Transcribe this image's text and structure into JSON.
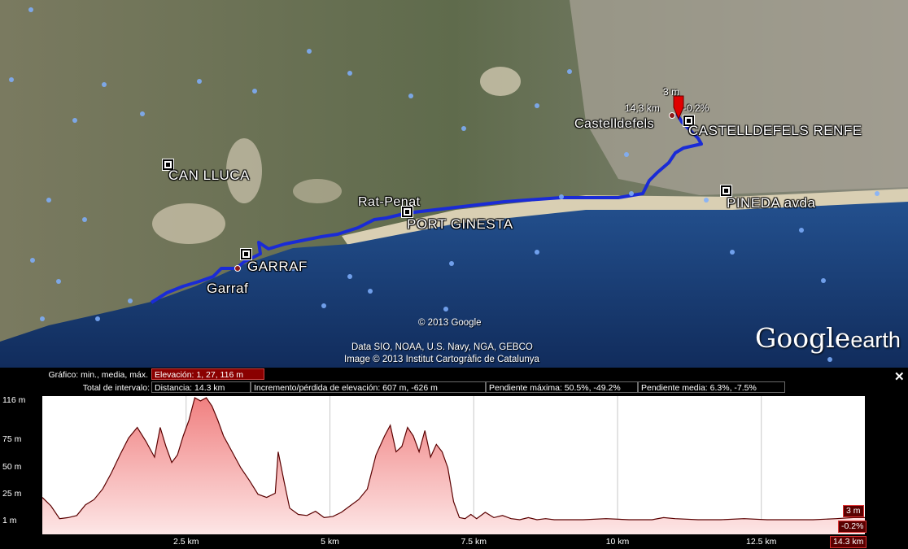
{
  "map": {
    "places": [
      {
        "id": "can-lluca",
        "label": "CAN LLUCA"
      },
      {
        "id": "garraf-upper",
        "label": "GARRAF"
      },
      {
        "id": "garraf",
        "label": "Garraf"
      },
      {
        "id": "rat-penat",
        "label": "Rat-Penat"
      },
      {
        "id": "port-ginesta",
        "label": "PORT GINESTA"
      },
      {
        "id": "castelldefels",
        "label": "Castelldefels"
      },
      {
        "id": "castelldefels-renfe",
        "label": "CASTELLDEFELS RENFE"
      },
      {
        "id": "pineda",
        "label": "PINEDA avda"
      }
    ],
    "marker": {
      "elevation": "3 m",
      "distance": "14,3 km",
      "slope": "-0.2%"
    },
    "credits": {
      "copyright": "© 2013 Google",
      "data": "Data SIO, NOAA, U.S. Navy, NGA, GEBCO",
      "image": "Image © 2013 Institut Cartogràfic de Catalunya"
    },
    "logo": {
      "google": "Google",
      "earth": "earth"
    },
    "colors": {
      "track": "#1a2bd6",
      "sea": "#1b3f7a",
      "land": "#6f7358"
    }
  },
  "panel": {
    "row1_label": "Gráfico: min., media, máx.",
    "row2_label": "Total de intervalo:",
    "stats": {
      "elevation": "Elevación: 1, 27, 116 m",
      "distance": "Distancia: 14.3 km",
      "gain_loss": "Incremento/pérdida de elevación: 607 m, -626 m",
      "max_slope": "Pendiente máxima: 50.5%, -49.2%",
      "avg_slope": "Pendiente media: 6.3%, -7.5%"
    },
    "close_label": "✕",
    "cursor": {
      "elevation": "3 m",
      "slope": "-0.2%",
      "distance": "14.3 km"
    }
  },
  "chart_data": {
    "type": "area",
    "title": "",
    "xlabel": "",
    "ylabel": "",
    "x_ticks": [
      "2.5 km",
      "5 km",
      "7.5 km",
      "10 km",
      "12.5 km"
    ],
    "y_ticks": [
      "116 m",
      "75 m",
      "50 m",
      "25 m",
      "1 m"
    ],
    "xlim": [
      0,
      14.3
    ],
    "ylim": [
      1,
      116
    ],
    "grid": true,
    "fill_color": "#f4b8b8",
    "line_color": "#5a0000",
    "series": [
      {
        "x": [
          0,
          0.15,
          0.3,
          0.45,
          0.6,
          0.75,
          0.9,
          1.05,
          1.2,
          1.35,
          1.5,
          1.65,
          1.8,
          1.95,
          2.05,
          2.15,
          2.25,
          2.35,
          2.45,
          2.55,
          2.65,
          2.75,
          2.85,
          2.95,
          3.05,
          3.15,
          3.3,
          3.45,
          3.6,
          3.75,
          3.9,
          4.05,
          4.1,
          4.2,
          4.3,
          4.45,
          4.6,
          4.75,
          4.9,
          5.05,
          5.2,
          5.35,
          5.5,
          5.65,
          5.8,
          5.95,
          6.05,
          6.15,
          6.25,
          6.35,
          6.45,
          6.55,
          6.65,
          6.75,
          6.85,
          6.95,
          7.05,
          7.15,
          7.25,
          7.35,
          7.45,
          7.55,
          7.7,
          7.85,
          8.0,
          8.15,
          8.3,
          8.45,
          8.6,
          8.75,
          8.9,
          9.1,
          9.4,
          9.8,
          10.2,
          10.6,
          10.8,
          11.0,
          11.4,
          11.8,
          12.2,
          12.6,
          13.0,
          13.4,
          13.8,
          14.1,
          14.3
        ],
        "y": [
          22,
          14,
          2,
          3,
          5,
          15,
          20,
          30,
          45,
          62,
          78,
          88,
          75,
          60,
          88,
          70,
          55,
          62,
          80,
          95,
          116,
          113,
          116,
          108,
          95,
          80,
          65,
          50,
          38,
          25,
          22,
          26,
          65,
          38,
          12,
          6,
          5,
          9,
          3,
          4,
          8,
          14,
          20,
          30,
          62,
          80,
          90,
          65,
          70,
          88,
          80,
          65,
          85,
          60,
          72,
          65,
          50,
          18,
          3,
          2,
          6,
          2,
          8,
          3,
          5,
          2,
          1,
          3,
          1,
          2,
          1,
          1,
          1,
          2,
          1,
          1,
          3,
          2,
          1,
          1,
          2,
          1,
          1,
          1,
          2,
          3,
          3
        ]
      }
    ]
  }
}
